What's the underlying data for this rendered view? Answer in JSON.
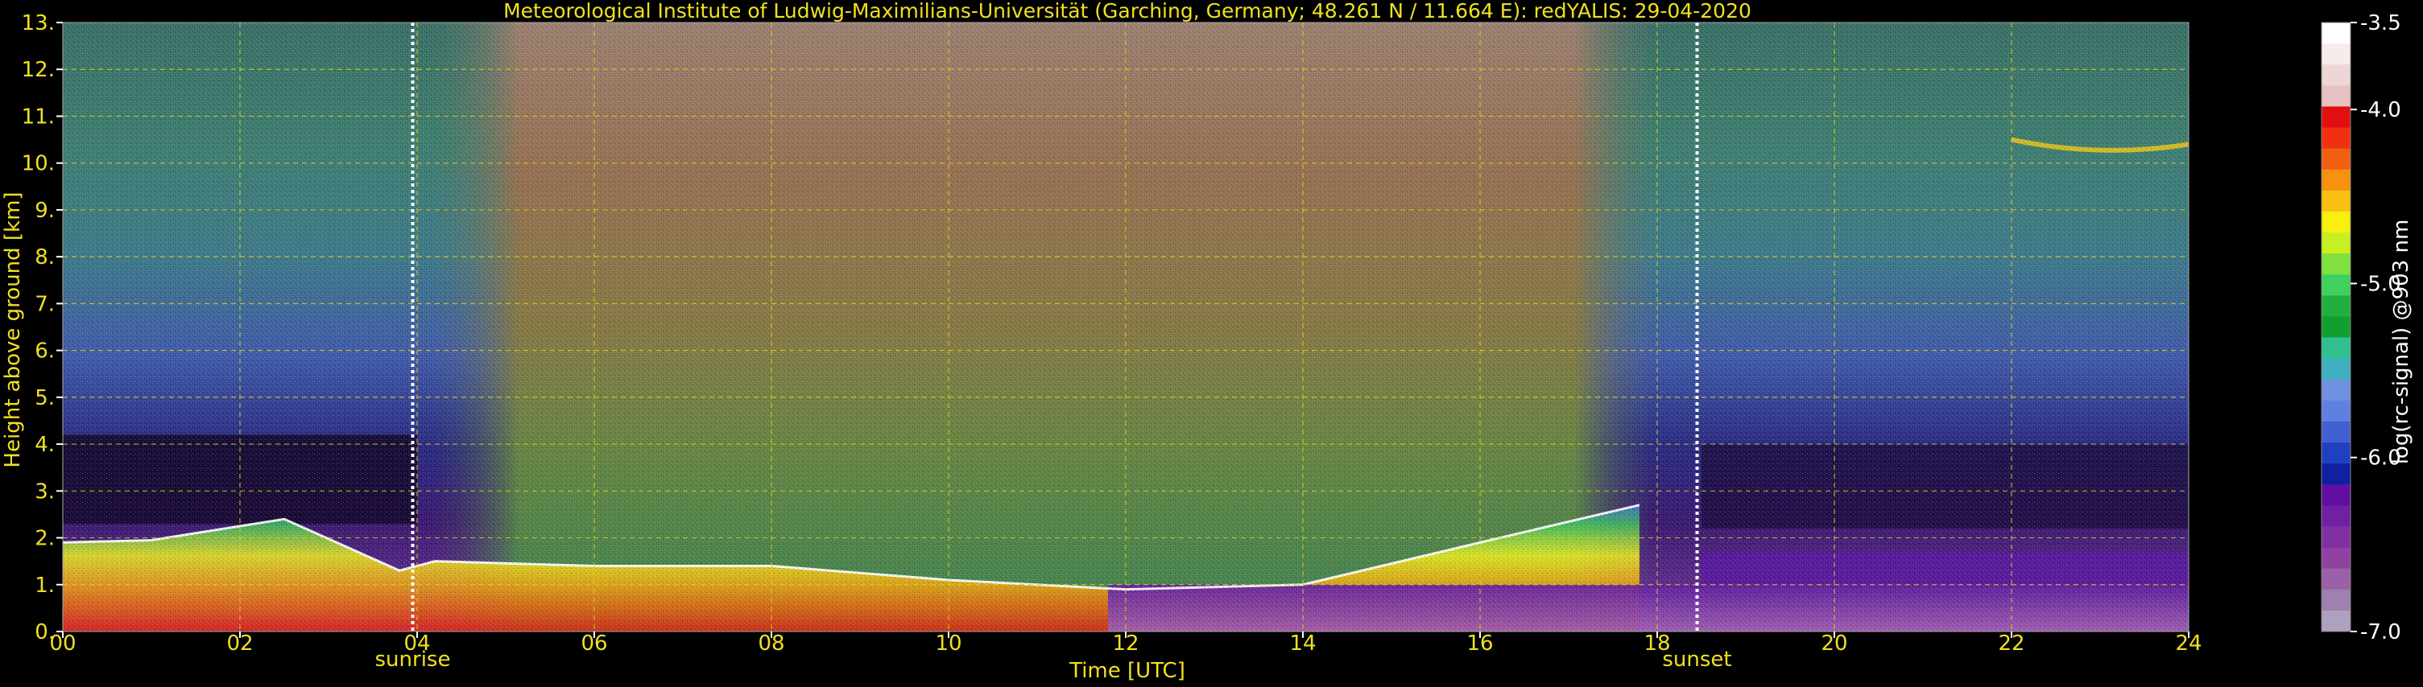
{
  "chart_data": {
    "type": "heatmap",
    "title": "Meteorological Institute of Ludwig-Maximilians-Universität (Garching, Germany; 48.261 N / 11.664 E):    redYALIS: 29-04-2020",
    "xlabel": "Time [UTC]",
    "ylabel": "Height above ground [km]",
    "xlim": [
      0,
      24
    ],
    "ylim": [
      0,
      13
    ],
    "x_ticks": [
      "00",
      "02",
      "04",
      "06",
      "08",
      "10",
      "12",
      "14",
      "16",
      "18",
      "20",
      "22",
      "24"
    ],
    "y_ticks": [
      "0.",
      "1.",
      "2.",
      "3.",
      "4.",
      "5.",
      "6.",
      "7.",
      "8.",
      "9.",
      "10.",
      "11.",
      "12.",
      "13."
    ],
    "grid": true,
    "events": [
      {
        "label": "sunrise",
        "time": 3.95
      },
      {
        "label": "sunset",
        "time": 18.45
      }
    ],
    "colorbar": {
      "label": "log(rc-signal) @903 nm",
      "range": [
        -7.0,
        -3.5
      ],
      "ticks": [
        "-3.5",
        "-4.0",
        "-5.0",
        "-6.0",
        "-7.0"
      ],
      "colors": [
        "#ffffff",
        "#f7ecec",
        "#efd6d6",
        "#e8c2c2",
        "#e01010",
        "#f03010",
        "#f06010",
        "#f89010",
        "#f8c010",
        "#f8f010",
        "#c8f020",
        "#80e040",
        "#40d060",
        "#20b040",
        "#10a030",
        "#30c090",
        "#40b0c0",
        "#7090e0",
        "#6080e0",
        "#4060d0",
        "#2040c0",
        "#1020a0",
        "#6010a0",
        "#7020a0",
        "#8030a0",
        "#9040a0",
        "#9a60a8",
        "#a080b0",
        "#b0a0c0"
      ]
    },
    "signal_profile": [
      {
        "time": 0.0,
        "boundary_layer_top_km": 1.9
      },
      {
        "time": 1.0,
        "boundary_layer_top_km": 1.95
      },
      {
        "time": 2.5,
        "boundary_layer_top_km": 2.4
      },
      {
        "time": 3.8,
        "boundary_layer_top_km": 1.3
      },
      {
        "time": 4.2,
        "boundary_layer_top_km": 1.5
      },
      {
        "time": 6.0,
        "boundary_layer_top_km": 1.4
      },
      {
        "time": 8.0,
        "boundary_layer_top_km": 1.4
      },
      {
        "time": 10.0,
        "boundary_layer_top_km": 1.1
      },
      {
        "time": 12.0,
        "boundary_layer_top_km": 0.9
      },
      {
        "time": 14.0,
        "boundary_layer_top_km": 1.0
      },
      {
        "time": 16.0,
        "boundary_layer_top_km": 1.9
      },
      {
        "time": 17.8,
        "boundary_layer_top_km": 2.7
      }
    ]
  }
}
